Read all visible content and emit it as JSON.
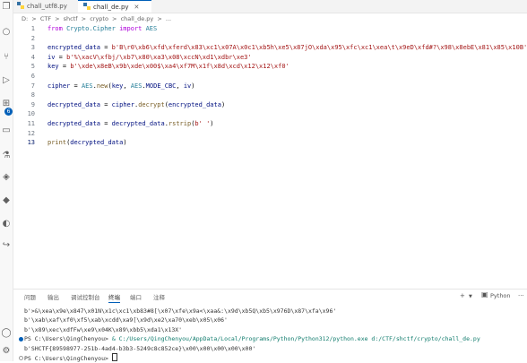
{
  "tabs": [
    {
      "label": "chall_utf8.py",
      "active": false
    },
    {
      "label": "chall_de.py",
      "active": true
    }
  ],
  "breadcrumb": [
    "D:",
    ">",
    "CTF",
    ">",
    "shctf",
    ">",
    "crypto",
    ">",
    "chall_de.py",
    ">",
    "..."
  ],
  "editor": {
    "lines": [
      {
        "n": "1",
        "code": [
          [
            "kw",
            "from "
          ],
          [
            "mod",
            "Crypto.Cipher"
          ],
          [
            "kw",
            " import "
          ],
          [
            "mod",
            "AES"
          ]
        ]
      },
      {
        "n": "2",
        "code": []
      },
      {
        "n": "3",
        "code": [
          [
            "var",
            "encrypted_data"
          ],
          [
            "op",
            " = "
          ],
          [
            "str",
            "b'B\\r0\\xb6\\xfd\\xferd\\x83\\xc1\\x07A\\x0c1\\xb5h\\xe5\\x87jO\\xda\\x95\\xfc\\xc1\\xea\\t\\x9eD\\xfd#?\\x98\\x8ebE\\x81\\x85\\x10B'"
          ]
        ]
      },
      {
        "n": "4",
        "code": [
          [
            "var",
            "iv"
          ],
          [
            "op",
            " = "
          ],
          [
            "str",
            "b'%\\xacV\\xfbj/\\xb7\\x80\\xa3\\x08\\xccN\\xd1\\xdbr\\xe3'"
          ]
        ]
      },
      {
        "n": "5",
        "code": [
          [
            "var",
            "key"
          ],
          [
            "op",
            " = "
          ],
          [
            "str",
            "b'\\xde\\x8eB\\x9b\\xde\\x00$\\xa4\\xf7M\\x1f\\x8d\\xcd\\x12\\x12\\xf0'"
          ]
        ]
      },
      {
        "n": "6",
        "code": []
      },
      {
        "n": "7",
        "code": [
          [
            "var",
            "cipher"
          ],
          [
            "op",
            " = "
          ],
          [
            "mod",
            "AES"
          ],
          [
            "op",
            "."
          ],
          [
            "fn",
            "new"
          ],
          [
            "op",
            "("
          ],
          [
            "var",
            "key"
          ],
          [
            "op",
            ", "
          ],
          [
            "mod",
            "AES"
          ],
          [
            "op",
            "."
          ],
          [
            "var",
            "MODE_CBC"
          ],
          [
            "op",
            ", "
          ],
          [
            "var",
            "iv"
          ],
          [
            "op",
            ")"
          ]
        ]
      },
      {
        "n": "8",
        "code": []
      },
      {
        "n": "9",
        "code": [
          [
            "var",
            "decrypted_data"
          ],
          [
            "op",
            " = "
          ],
          [
            "var",
            "cipher"
          ],
          [
            "op",
            "."
          ],
          [
            "fn",
            "decrypt"
          ],
          [
            "op",
            "("
          ],
          [
            "var",
            "encrypted_data"
          ],
          [
            "op",
            ")"
          ]
        ]
      },
      {
        "n": "10",
        "code": []
      },
      {
        "n": "11",
        "code": [
          [
            "var",
            "decrypted_data"
          ],
          [
            "op",
            " = "
          ],
          [
            "var",
            "decrypted_data"
          ],
          [
            "op",
            "."
          ],
          [
            "fn",
            "rstrip"
          ],
          [
            "op",
            "("
          ],
          [
            "str",
            "b' '"
          ],
          [
            "op",
            ")"
          ]
        ]
      },
      {
        "n": "12",
        "code": []
      },
      {
        "n": "13",
        "code": [
          [
            "fn",
            "print"
          ],
          [
            "op",
            "("
          ],
          [
            "var",
            "decrypted_data"
          ],
          [
            "op",
            ")"
          ]
        ]
      }
    ]
  },
  "panel": {
    "tabs": [
      "问题",
      "输出",
      "调试控制台",
      "终端",
      "端口",
      "注释"
    ],
    "active_tab": "终端",
    "tools_label": "Python",
    "plus_label": "+",
    "more_label": "···"
  },
  "terminal": {
    "lines": [
      {
        "text": "b'>&\\xea\\x9e\\x847\\x01N\\x1c\\xc1\\xb83#8[\\x07\\xfe\\x9a<\\xaa&:\\x9d\\xb5Q\\xb5\\x976D\\x87\\xfa\\x96'",
        "dot": ""
      },
      {
        "text": "b'\\xab\\xaf\\xf0\\xf5\\xab\\xcdd\\xa9[\\x9d\\xe2\\xa70\\xeb\\x05\\x06'",
        "dot": ""
      },
      {
        "text": "b'\\x89\\xec\\xdfFw\\xe9\\x04K\\x89\\xbb5\\xda1\\x13X'",
        "dot": ""
      },
      {
        "text_prompt": "PS C:\\Users\\QingChenyou> ",
        "text_cmd": "& C:/Users/QingChenyou/AppData/Local/Programs/Python/Python312/python.exe d:/CTF/shctf/crypto/chall_de.py",
        "dot": "blue"
      },
      {
        "text": "b'SHCTF{89598977-251b-4ad4-b3b3-5249c8c852ce}\\x00\\x00\\x00\\x00\\x00'",
        "dot": ""
      },
      {
        "text": "PS C:\\Users\\QingChenyou> ",
        "dot": "hollow",
        "cursor": true
      }
    ]
  }
}
